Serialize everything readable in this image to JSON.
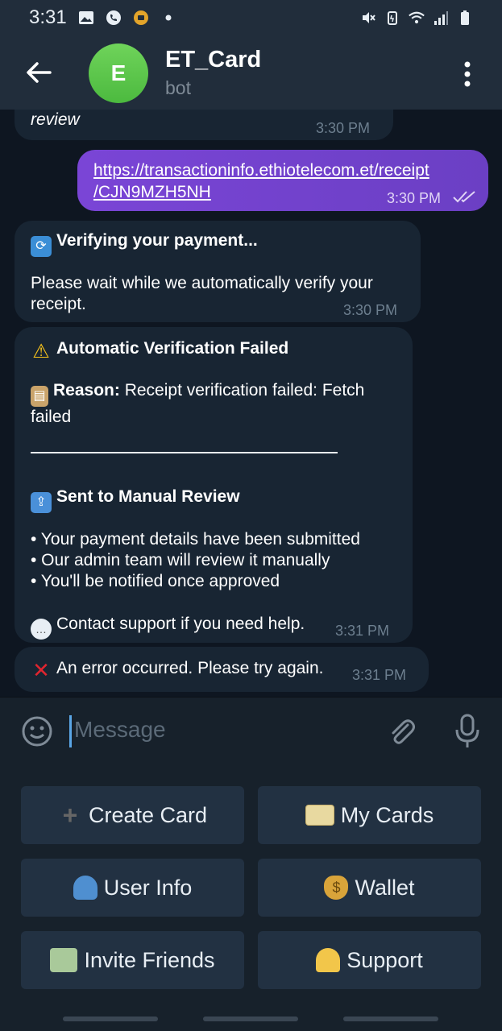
{
  "status_bar": {
    "time": "3:31"
  },
  "header": {
    "avatar_letter": "E",
    "title": "ET_Card",
    "subtitle": "bot"
  },
  "messages": {
    "partial": {
      "text": "review",
      "time": "3:30 PM"
    },
    "outgoing": {
      "link_line1": "https://transactioninfo.ethiotelecom.et/receipt",
      "link_line2": "/CJN9MZH5NH",
      "time": "3:30 PM"
    },
    "verifying": {
      "title": "Verifying your payment...",
      "body": "Please wait while we automatically verify your receipt.",
      "time": "3:30 PM"
    },
    "failed": {
      "title": "Automatic Verification Failed",
      "reason_label": "Reason:",
      "reason_text": "Receipt verification failed: Fetch failed",
      "manual_title": "Sent to Manual Review",
      "bullet1": "• Your payment details have been submitted",
      "bullet2": "• Our admin team will review it manually",
      "bullet3": "• You'll be notified once approved",
      "contact": "Contact support if you need help.",
      "time": "3:31 PM"
    },
    "error": {
      "text": "An error occurred. Please try again.",
      "time": "3:31 PM"
    }
  },
  "input": {
    "placeholder": "Message"
  },
  "keyboard": {
    "create_card": "Create Card",
    "my_cards": "My Cards",
    "user_info": "User Info",
    "wallet": "Wallet",
    "invite_friends": "Invite Friends",
    "support": "Support"
  },
  "colors": {
    "accent": "#6b3fc4",
    "background": "#0e1621",
    "bubble": "#182533"
  }
}
